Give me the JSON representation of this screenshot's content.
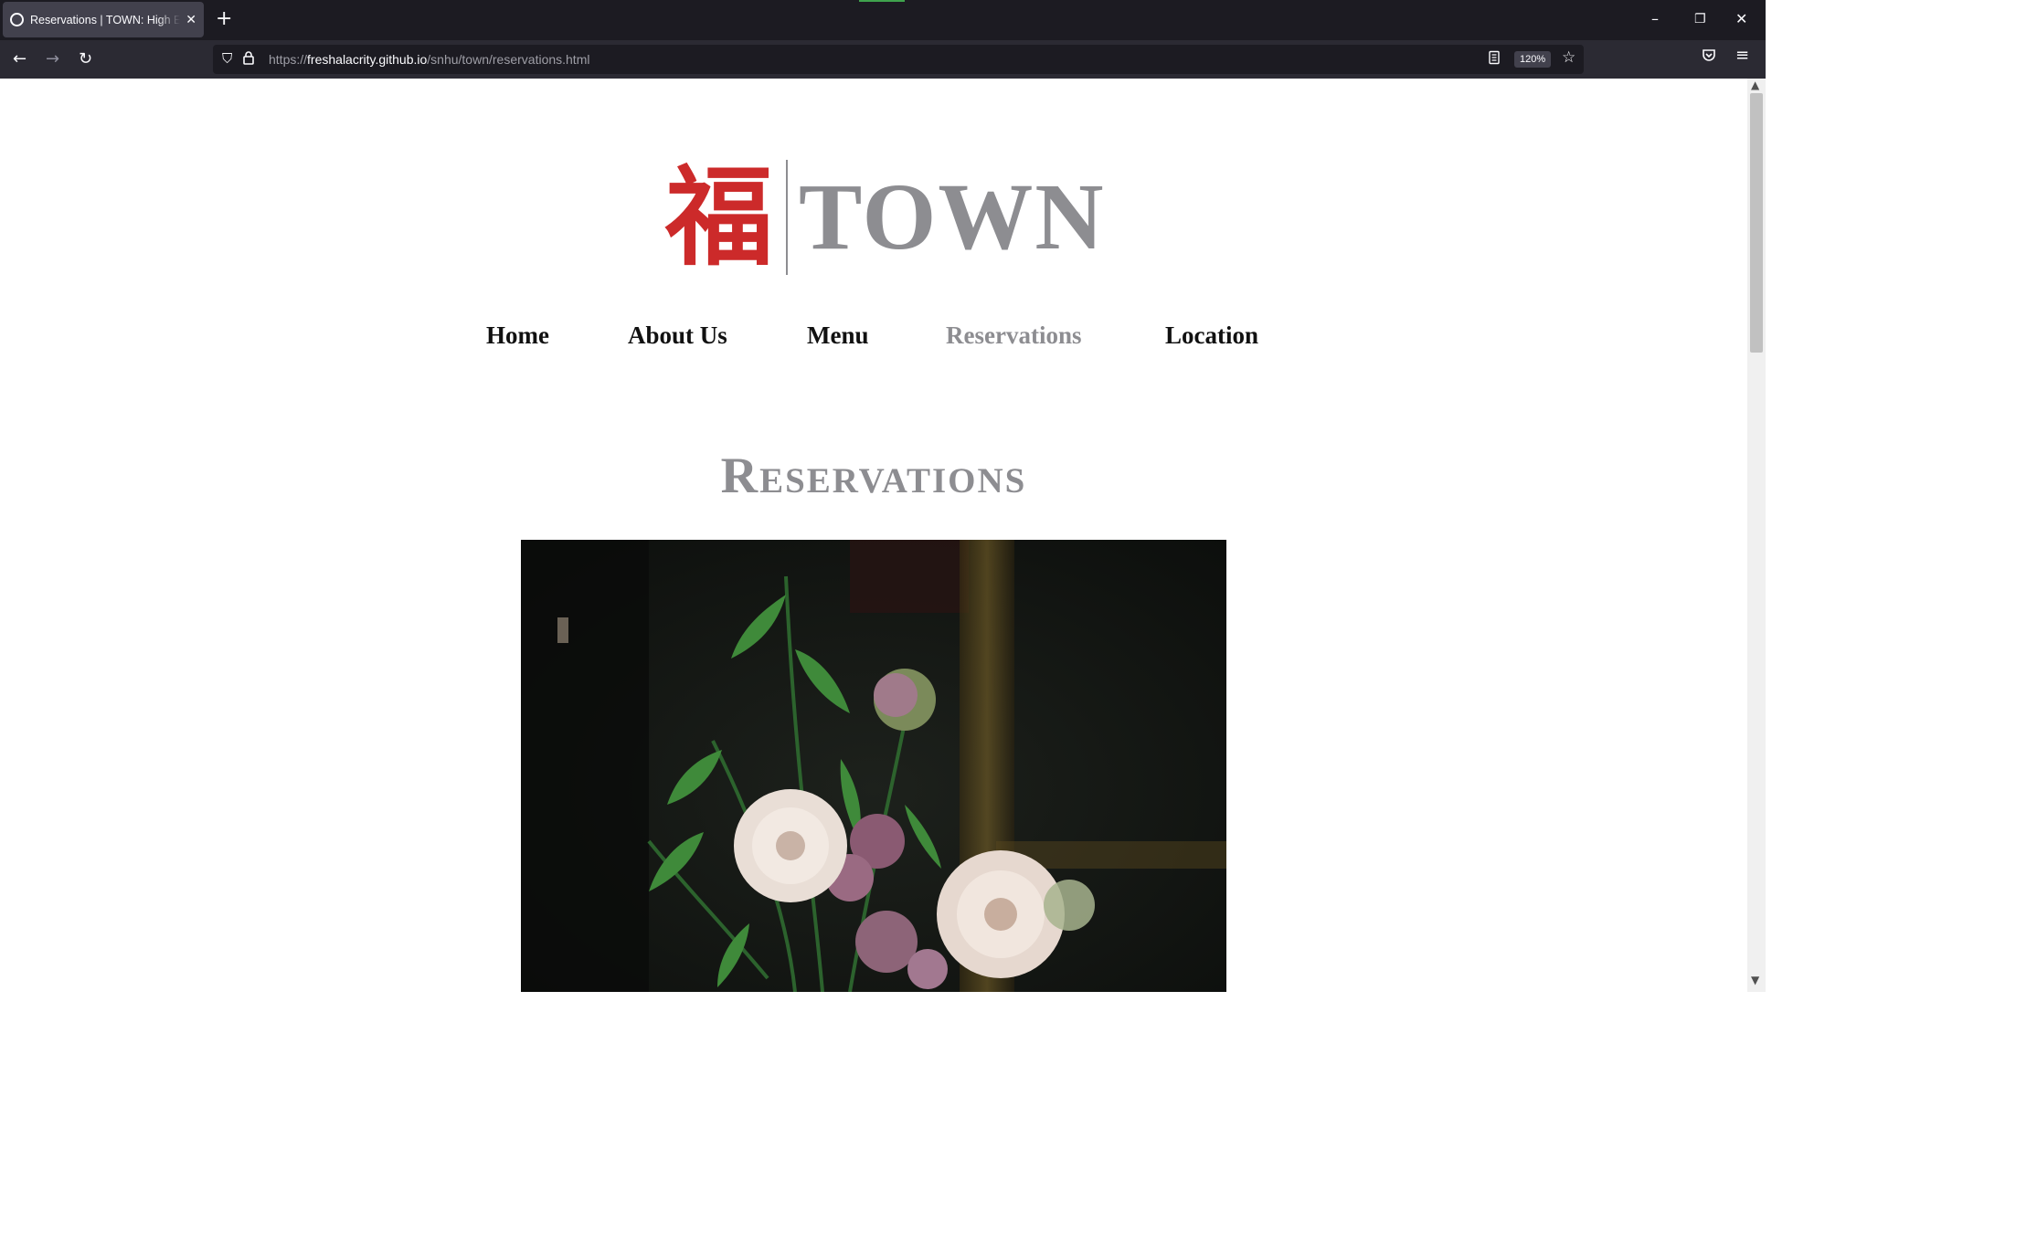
{
  "browser": {
    "tab": {
      "title": "Reservations | TOWN: High End"
    },
    "url": {
      "scheme": "https://",
      "host": "freshalacrity.github.io",
      "path": "/snhu/town/reservations.html"
    },
    "zoom": "120%"
  },
  "site": {
    "logo": {
      "character": "福",
      "wordmark": "TOWN"
    },
    "nav": [
      {
        "label": "Home"
      },
      {
        "label": "About Us"
      },
      {
        "label": "Menu"
      },
      {
        "label": "Reservations",
        "active": true
      },
      {
        "label": "Location"
      }
    ],
    "page_title": "Reservations",
    "hero_image": {
      "subject": "flower-arrangement"
    }
  },
  "colors": {
    "logo_red": "#cc2a2a",
    "logo_gray": "#8d8d91",
    "nav_text": "#111111",
    "nav_active": "#8d8d91"
  },
  "icons": [
    "shield-icon",
    "lock-icon",
    "reader-view-icon",
    "bookmark-star-icon",
    "pocket-icon",
    "menu-icon"
  ]
}
